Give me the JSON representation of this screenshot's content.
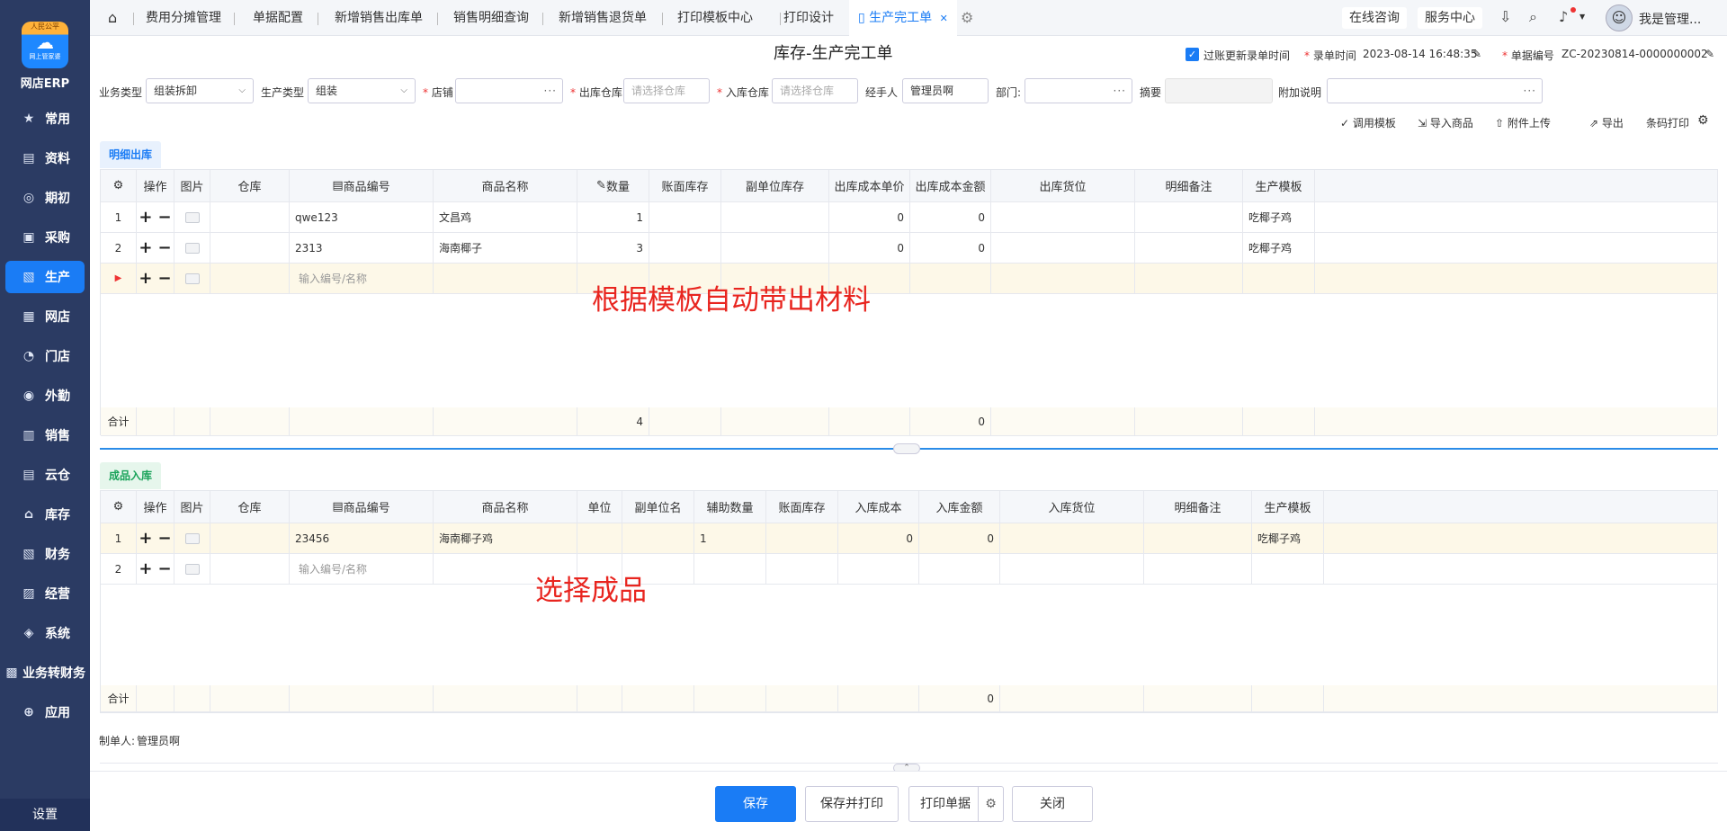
{
  "sidebar": {
    "logo_tag": "人民公平",
    "logo_sub": "网上管家婆",
    "brand": "网店ERP",
    "items": [
      {
        "label": "常用",
        "icon": "star-icon",
        "glyph": "★"
      },
      {
        "label": "资料",
        "icon": "document-icon",
        "glyph": "▤"
      },
      {
        "label": "期初",
        "icon": "clock-icon",
        "glyph": "◎"
      },
      {
        "label": "采购",
        "icon": "purchase-icon",
        "glyph": "▣"
      },
      {
        "label": "生产",
        "icon": "production-icon",
        "glyph": "▧"
      },
      {
        "label": "网店",
        "icon": "store-icon",
        "glyph": "▦"
      },
      {
        "label": "门店",
        "icon": "pie-icon",
        "glyph": "◔"
      },
      {
        "label": "外勤",
        "icon": "field-icon",
        "glyph": "◉"
      },
      {
        "label": "销售",
        "icon": "sales-icon",
        "glyph": "▥"
      },
      {
        "label": "云仓",
        "icon": "warehouse-icon",
        "glyph": "▤"
      },
      {
        "label": "库存",
        "icon": "inventory-icon",
        "glyph": "⌂"
      },
      {
        "label": "财务",
        "icon": "finance-icon",
        "glyph": "▧"
      },
      {
        "label": "经营",
        "icon": "operation-icon",
        "glyph": "▨"
      },
      {
        "label": "系统",
        "icon": "system-icon",
        "glyph": "◈"
      },
      {
        "label": "业务转财务",
        "icon": "transfer-icon",
        "glyph": "▩"
      },
      {
        "label": "应用",
        "icon": "apps-icon",
        "glyph": "⊕"
      }
    ],
    "active_index": 4,
    "settings": "设置"
  },
  "tabs": {
    "home_glyph": "⌂",
    "items": [
      "费用分摊管理",
      "单据配置",
      "新增销售出库单",
      "销售明细查询",
      "新增销售退货单",
      "打印模板中心",
      "打印设计"
    ],
    "active": "生产完工单",
    "active_glyph": "▯",
    "close_glyph": "✕",
    "gear_glyph": "⚙"
  },
  "topbar": {
    "consult": "在线咨询",
    "service": "服务中心",
    "user": "我是管理...",
    "download_glyph": "⇩",
    "search_glyph": "⌕",
    "bell_glyph": "♪",
    "avatar_glyph": "☺"
  },
  "header": {
    "title": "库存-生产完工单",
    "update_time_label": "过账更新录单时间",
    "record_time_label": "录单时间",
    "record_time_value": "2023-08-14 16:48:35",
    "bill_no_label": "单据编号",
    "bill_no_value": "ZC-20230814-0000000002"
  },
  "form": {
    "biz_type_label": "业务类型",
    "biz_type_value": "组装拆卸",
    "prod_type_label": "生产类型",
    "prod_type_value": "组装",
    "store_label": "店铺",
    "store_value": "",
    "out_wh_label": "出库仓库",
    "out_wh_placeholder": "请选择仓库",
    "in_wh_label": "入库仓库",
    "in_wh_placeholder": "请选择仓库",
    "handler_label": "经手人",
    "handler_value": "管理员啊",
    "dept_label": "部门:",
    "dept_value": "",
    "summary_label": "摘要",
    "summary_value": "",
    "extra_label": "附加说明",
    "extra_value": ""
  },
  "toolbar": {
    "template": "调用模板",
    "import": "导入商品",
    "attach": "附件上传",
    "export": "导出",
    "barcode": "条码打印"
  },
  "out_section": {
    "tab": "明细出库",
    "headers": [
      "操作",
      "图片",
      "仓库",
      "商品编号",
      "商品名称",
      "数量",
      "账面库存",
      "副单位库存",
      "出库成本单价",
      "出库成本金额",
      "出库货位",
      "明细备注",
      "生产模板"
    ],
    "rows": [
      {
        "no": "1",
        "code": "qwe123",
        "name": "文昌鸡",
        "qty": "1",
        "price": "0",
        "amount": "0",
        "template": "吃椰子鸡"
      },
      {
        "no": "2",
        "code": "2313",
        "name": "海南椰子",
        "qty": "3",
        "price": "0",
        "amount": "0",
        "template": "吃椰子鸡"
      }
    ],
    "input_placeholder": "输入编号/名称",
    "total_label": "合计",
    "total_qty": "4",
    "total_amount": "0"
  },
  "in_section": {
    "tab": "成品入库",
    "headers": [
      "操作",
      "图片",
      "仓库",
      "商品编号",
      "商品名称",
      "单位",
      "副单位名",
      "辅助数量",
      "账面库存",
      "入库成本",
      "入库金额",
      "入库货位",
      "明细备注",
      "生产模板"
    ],
    "rows": [
      {
        "no": "1",
        "code": "23456",
        "name": "海南椰子鸡",
        "aux_qty": "1",
        "cost": "0",
        "amount": "0",
        "template": "吃椰子鸡"
      }
    ],
    "input_no": "2",
    "input_placeholder": "输入编号/名称",
    "total_label": "合计",
    "total_amount": "0"
  },
  "annotations": {
    "top": "根据模板自动带出材料",
    "bottom": "选择成品"
  },
  "maker": {
    "label": "制单人:",
    "value": "管理员啊"
  },
  "footer": {
    "save": "保存",
    "save_print": "保存并打印",
    "print": "打印单据",
    "close": "关闭"
  }
}
